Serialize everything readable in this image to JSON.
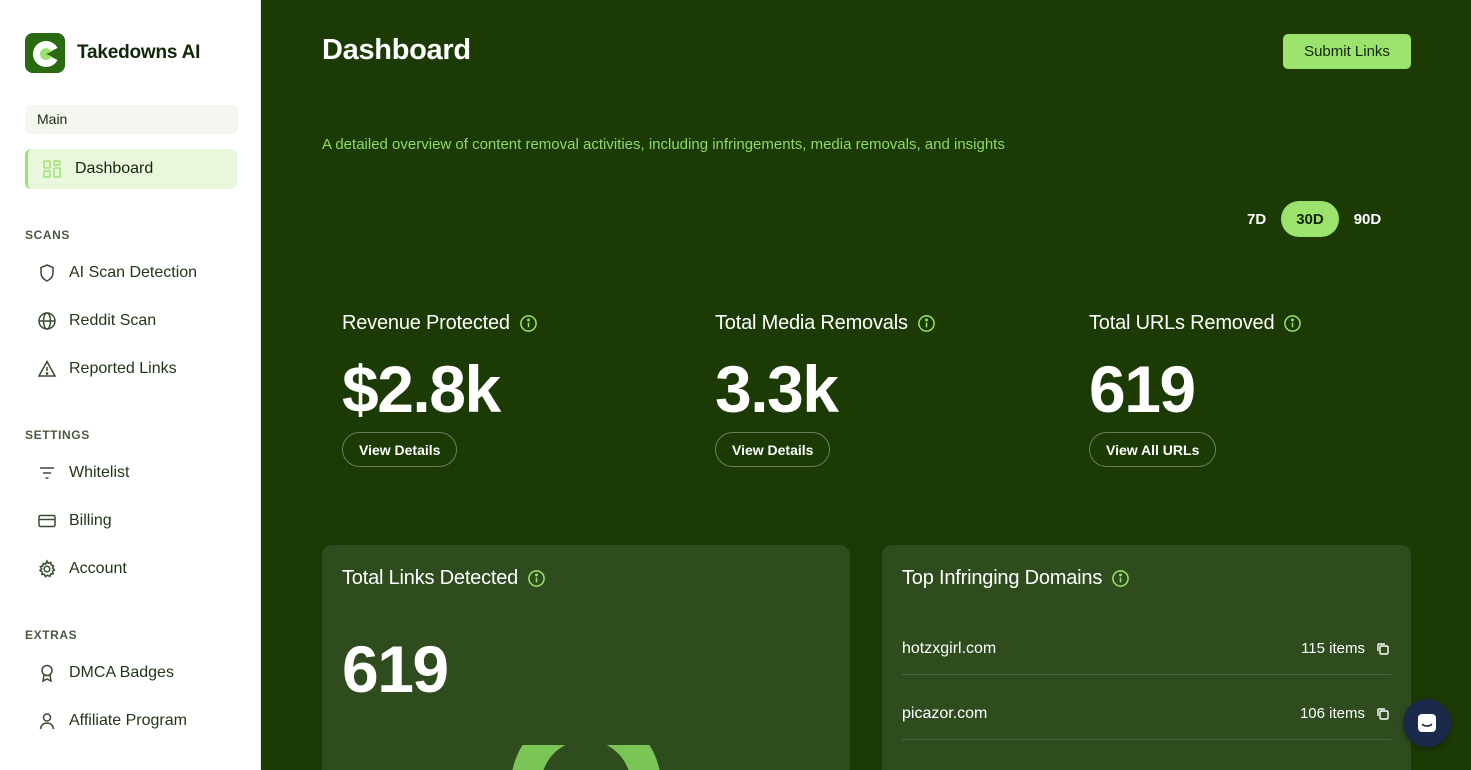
{
  "brand": {
    "name": "Takedowns AI"
  },
  "sidebar": {
    "main_section": "Main",
    "active_item": {
      "label": "Dashboard",
      "icon": "grid-icon"
    },
    "scans_heading": "SCANS",
    "scans": [
      {
        "label": "AI Scan Detection",
        "icon": "shield-icon"
      },
      {
        "label": "Reddit Scan",
        "icon": "globe-icon"
      },
      {
        "label": "Reported Links",
        "icon": "warning-icon"
      }
    ],
    "settings_heading": "SETTINGS",
    "settings": [
      {
        "label": "Whitelist",
        "icon": "filter-icon"
      },
      {
        "label": "Billing",
        "icon": "credit-card-icon"
      },
      {
        "label": "Account",
        "icon": "gear-icon"
      }
    ],
    "extras_heading": "EXTRAS",
    "extras": [
      {
        "label": "DMCA Badges",
        "icon": "award-icon"
      },
      {
        "label": "Affiliate Program",
        "icon": "user-icon"
      }
    ]
  },
  "header": {
    "title": "Dashboard",
    "submit_label": "Submit Links",
    "subtitle": "A detailed overview of content removal activities, including infringements, media removals, and insights"
  },
  "range": {
    "options": [
      "7D",
      "30D",
      "90D"
    ],
    "selected": "30D"
  },
  "stats": [
    {
      "label": "Revenue Protected",
      "value": "$2.8k",
      "button": "View Details"
    },
    {
      "label": "Total Media Removals",
      "value": "3.3k",
      "button": "View Details"
    },
    {
      "label": "Total URLs Removed",
      "value": "619",
      "button": "View All URLs"
    }
  ],
  "links_card": {
    "title": "Total Links Detected",
    "value": "619"
  },
  "domains_card": {
    "title": "Top Infringing Domains",
    "rows": [
      {
        "domain": "hotzxgirl.com",
        "count": "115 items"
      },
      {
        "domain": "picazor.com",
        "count": "106 items"
      }
    ]
  },
  "colors": {
    "accent": "#9be36d",
    "main_bg": "#1c3a04",
    "card_bg": "#2f4c1f",
    "subtitle": "#8fd86a"
  }
}
